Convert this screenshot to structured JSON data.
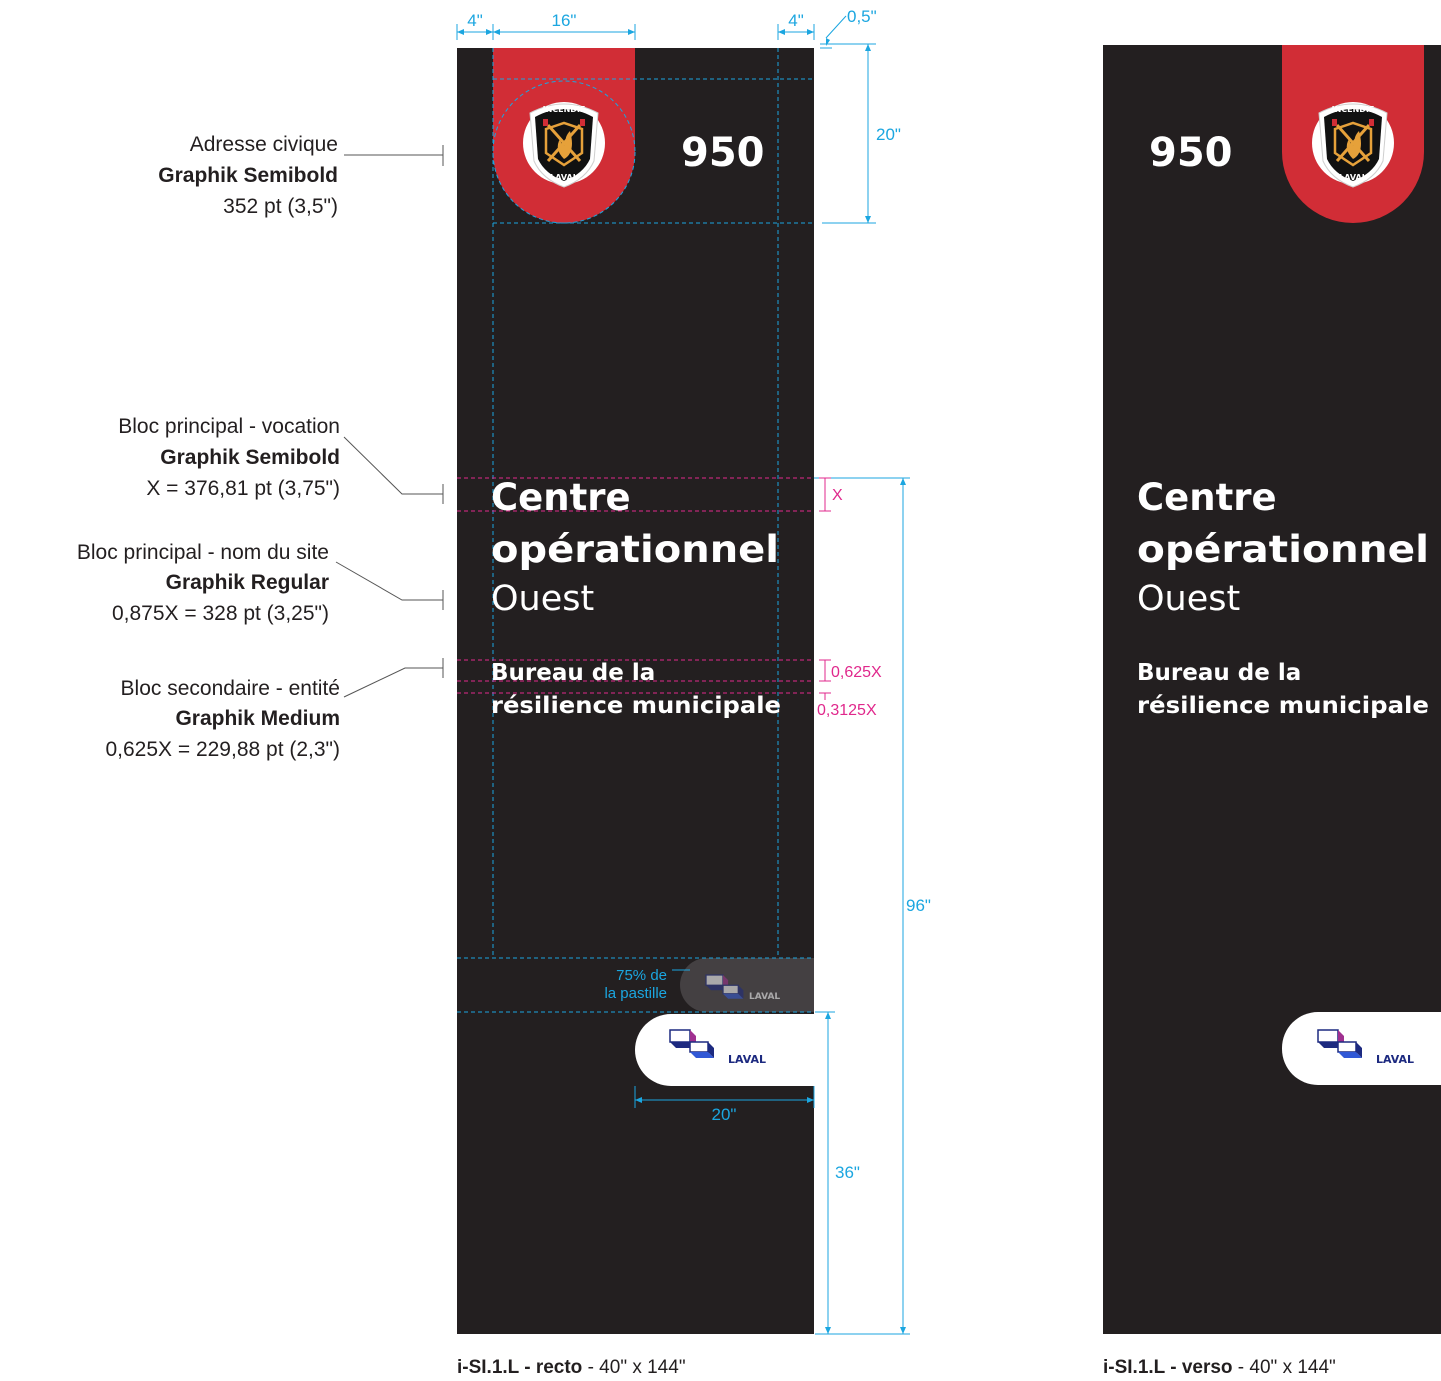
{
  "colors": {
    "panel": "#231f20",
    "red": "#d12d36",
    "white": "#ffffff",
    "cyan": "#1ba6e0",
    "magenta": "#e0288c",
    "annotation_line": "#555555",
    "logo_navy": "#1d2a80",
    "logo_purple": "#a03090",
    "logo_blue": "#3158d6",
    "badge_gold": "#e6a13a",
    "badge_black": "#111111"
  },
  "panel": {
    "address": "950",
    "main_line1": "Centre",
    "main_line2": "opérationnel",
    "site_name": "Ouest",
    "secondary_line1": "Bureau de la",
    "secondary_line2": "résilience municipale",
    "laval_wordmark": "LAVAL",
    "badge_top": "INCENDIE",
    "badge_bottom": "LAVAL"
  },
  "annotations": [
    {
      "title": "Adresse civique",
      "font": "Graphik Semibold",
      "size": "352 pt (3,5\")"
    },
    {
      "title": "Bloc principal - vocation",
      "font": "Graphik Semibold",
      "size": "X = 376,81 pt (3,75\")"
    },
    {
      "title": "Bloc principal - nom du site",
      "font": "Graphik Regular",
      "size": "0,875X = 328 pt (3,25\")"
    },
    {
      "title": "Bloc secondaire - entité",
      "font": "Graphik Medium",
      "size": "0,625X = 229,88 pt (2,3\")"
    }
  ],
  "dimensions": {
    "margin_left": "4\"",
    "pastille_width": "16\"",
    "margin_right": "4\"",
    "top_offset": "0,5\"",
    "header_height": "20\"",
    "x_label": "X",
    "gap_1": "0,625X",
    "gap_2": "0,3125X",
    "text_zone_height": "96\"",
    "logo_scale_line1": "75% de",
    "logo_scale_line2": "la pastille",
    "logo_width": "20\"",
    "bottom_height": "36\""
  },
  "captions": {
    "recto_code": "i-SI.1.L - recto",
    "recto_size": " - 40\" x 144\"",
    "verso_code": "i-SI.1.L - verso",
    "verso_size": " - 40\" x 144\""
  }
}
